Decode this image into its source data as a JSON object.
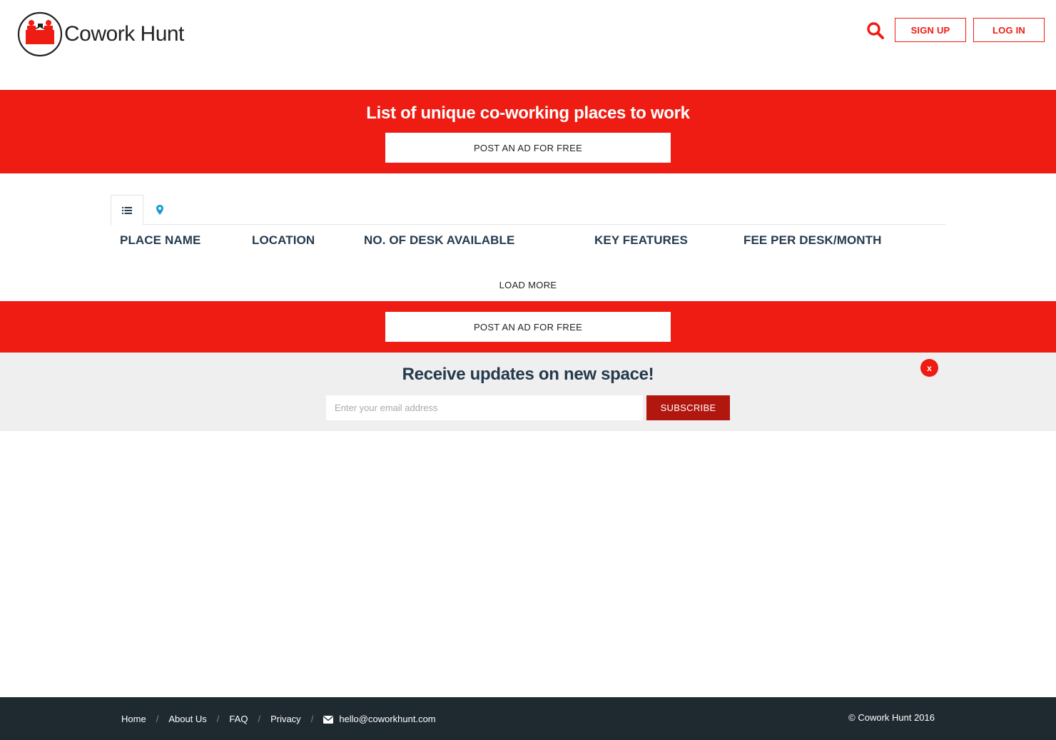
{
  "header": {
    "logo_text": "Cowork Hunt",
    "search_icon": "search-icon",
    "signup_label": "SIGN UP",
    "login_label": "LOG IN"
  },
  "hero": {
    "title": "List of unique co-working places to work",
    "post_ad_label": "POST AN AD FOR FREE"
  },
  "tabs": [
    {
      "icon": "list-icon",
      "active": true
    },
    {
      "icon": "map-marker-icon",
      "active": false
    }
  ],
  "table": {
    "columns": [
      "PLACE NAME",
      "LOCATION",
      "NO. OF DESK AVAILABLE",
      "KEY FEATURES",
      "FEE PER DESK/MONTH"
    ]
  },
  "load_more_label": "LOAD MORE",
  "band2": {
    "post_ad_label": "POST AN AD FOR FREE"
  },
  "subscribe": {
    "title": "Receive updates on new space!",
    "email_placeholder": "Enter your email address",
    "email_value": "",
    "button_label": "SUBSCRIBE",
    "close_label": "x"
  },
  "footer": {
    "links": [
      "Home",
      "About Us",
      "FAQ",
      "Privacy"
    ],
    "separator": "/",
    "email": "hello@coworkhunt.com",
    "copyright": "© Cowork Hunt 2016"
  },
  "colors": {
    "brand_red": "#ee1c12",
    "dark_red": "#b1160f",
    "navy": "#243a4d",
    "footer_bg": "#1f2a30",
    "map_icon_blue": "#1a9ad6"
  }
}
